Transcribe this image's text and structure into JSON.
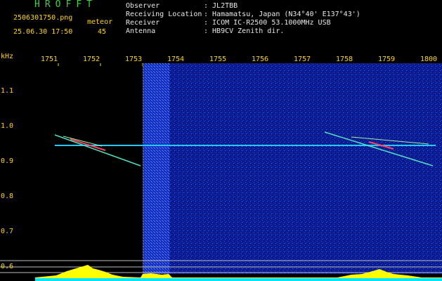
{
  "header": {
    "app_title": "HROFFT",
    "file_name": "2506301750.png",
    "mode_label": "meteor",
    "timestamp": "25.06.30 17:50",
    "count": "45"
  },
  "info": [
    {
      "label": "Observer",
      "value": ": JL2TBB"
    },
    {
      "label": "Receiving Location",
      "value": ": Hamamatsu, Japan (N34°40' E137°43')"
    },
    {
      "label": "Receiver",
      "value": ": ICOM IC-R2500 53.1000MHz USB"
    },
    {
      "label": "Antenna",
      "value": ": HB9CV Zenith dir."
    }
  ],
  "axis": {
    "unit": "kHz",
    "x_ticks": [
      "1751",
      "1752",
      "1753",
      "1754",
      "1755",
      "1756",
      "1757",
      "1758",
      "1759",
      "1800"
    ],
    "y_ticks": [
      "1.1",
      "1.0",
      "0.9",
      "0.8",
      "0.7",
      "0.6"
    ]
  },
  "colors": {
    "background": "#000000",
    "spectrum_noise": "#0a1aa0",
    "text_info": "#e8e8e8",
    "text_axis": "#ffd700",
    "title": "#39d43a",
    "carrier": "#22c8ff",
    "meteor_trail": "#ff4060",
    "bottom_profile": "#ffff00",
    "bottom_base": "#00e5ff"
  }
}
